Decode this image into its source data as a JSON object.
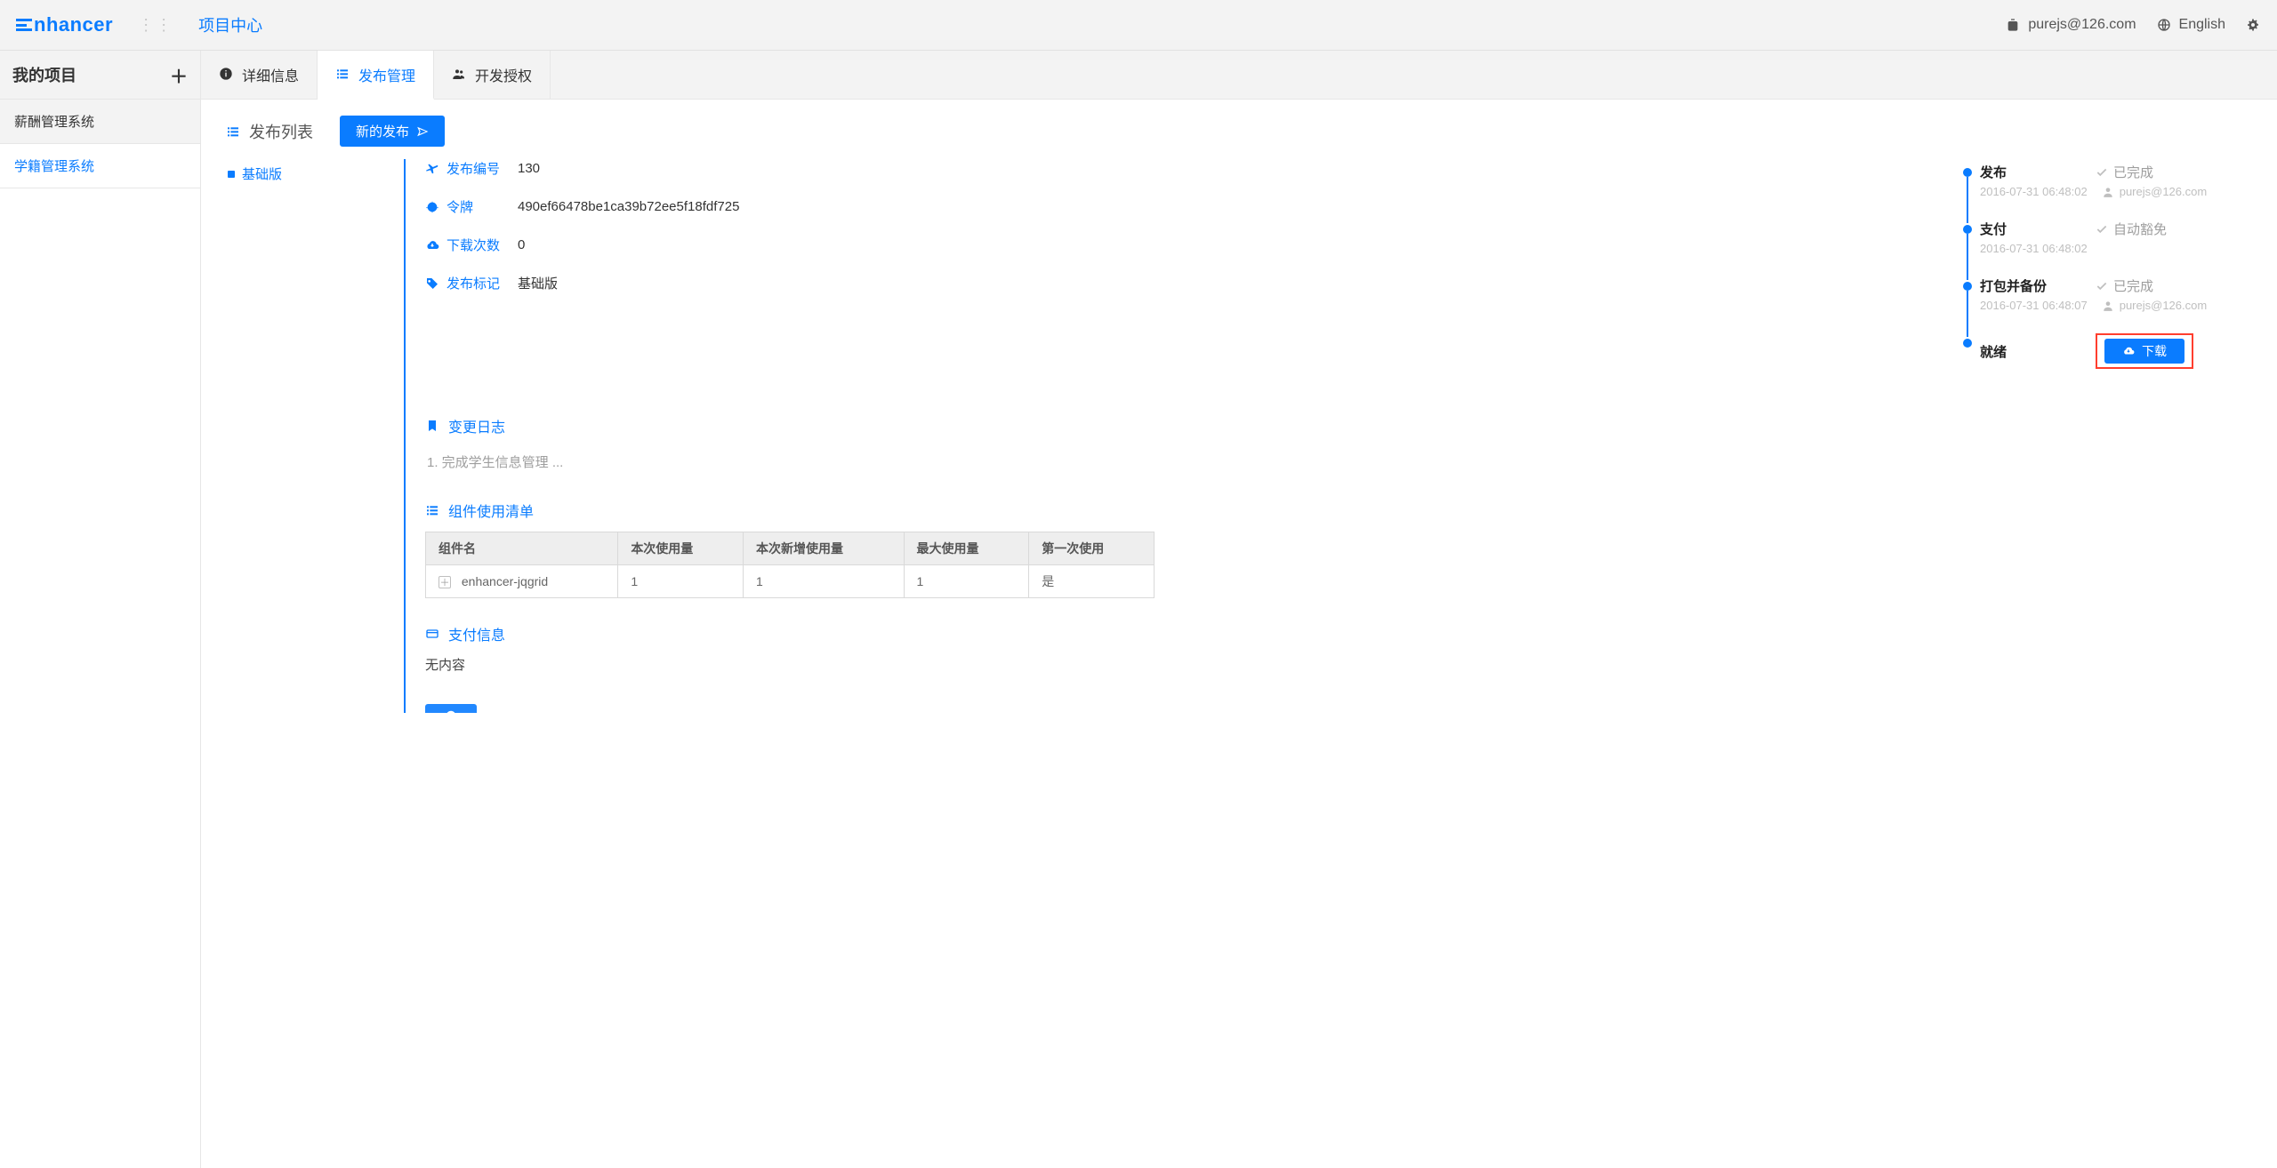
{
  "brand": "nhancer",
  "topbar": {
    "project_center": "项目中心",
    "user_email": "purejs@126.com",
    "lang": "English"
  },
  "side_header": {
    "title": "我的项目"
  },
  "projects": [
    {
      "name": "薪酬管理系统",
      "active": false
    },
    {
      "name": "学籍管理系统",
      "active": true
    }
  ],
  "tabs": [
    {
      "id": "detail",
      "label": "详细信息",
      "icon": "info",
      "active": false
    },
    {
      "id": "release",
      "label": "发布管理",
      "icon": "list",
      "active": true
    },
    {
      "id": "auth",
      "label": "开发授权",
      "icon": "users",
      "active": false
    }
  ],
  "release": {
    "list_title": "发布列表",
    "new_release_label": "新的发布",
    "versions": [
      {
        "name": "基础版",
        "active": true
      }
    ],
    "fields": {
      "release_no": {
        "label": "发布编号",
        "value": "130"
      },
      "token": {
        "label": "令牌",
        "value": "490ef66478be1ca39b72ee5f18fdf725"
      },
      "downloads": {
        "label": "下载次数",
        "value": "0"
      },
      "tag": {
        "label": "发布标记",
        "value": "基础版"
      }
    },
    "sections": {
      "changelog": {
        "title": "变更日志",
        "text": "1. 完成学生信息管理 ..."
      },
      "components": {
        "title": "组件使用清单",
        "headers": [
          "组件名",
          "本次使用量",
          "本次新增使用量",
          "最大使用量",
          "第一次使用"
        ],
        "rows": [
          {
            "name": "enhancer-jqgrid",
            "used": "1",
            "added": "1",
            "max": "1",
            "first": "是"
          }
        ]
      },
      "payment": {
        "title": "支付信息",
        "text": "无内容"
      }
    },
    "timeline": [
      {
        "title": "发布",
        "status": "已完成",
        "check": true,
        "time": "2016-07-31 06:48:02",
        "who": "purejs@126.com"
      },
      {
        "title": "支付",
        "status": "自动豁免",
        "check": true,
        "time": "2016-07-31 06:48:02",
        "who": ""
      },
      {
        "title": "打包并备份",
        "status": "已完成",
        "check": true,
        "time": "2016-07-31 06:48:07",
        "who": "purejs@126.com"
      },
      {
        "title": "就绪",
        "status": "",
        "check": false,
        "download_label": "下载",
        "highlight": true
      }
    ]
  }
}
